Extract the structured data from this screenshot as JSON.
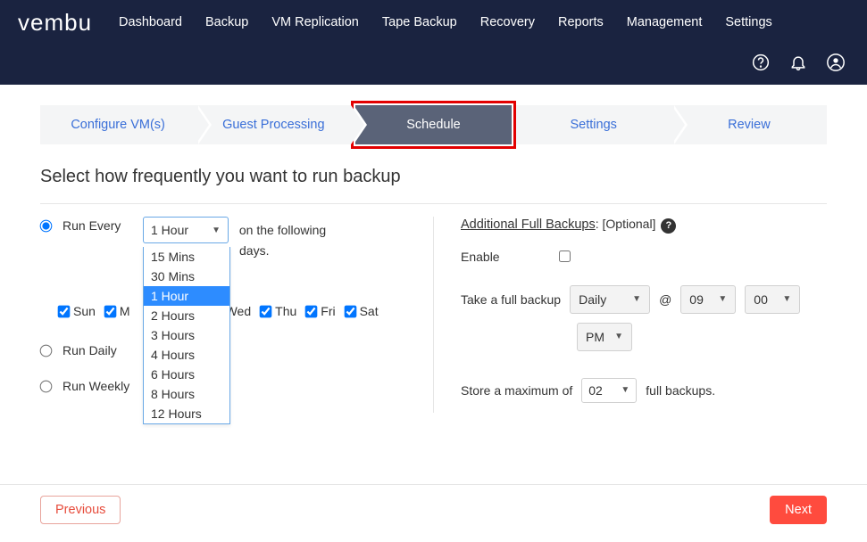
{
  "logo": "vembu",
  "nav": [
    "Dashboard",
    "Backup",
    "VM Replication",
    "Tape Backup",
    "Recovery",
    "Reports",
    "Management",
    "Settings"
  ],
  "wizard": {
    "steps": [
      "Configure VM(s)",
      "Guest Processing",
      "Schedule",
      "Settings",
      "Review"
    ],
    "active_index": 2
  },
  "heading": "Select how frequently you want to run backup",
  "left": {
    "run_every_label": "Run Every",
    "run_daily_label": "Run Daily",
    "run_weekly_label": "Run Weekly",
    "selected_mode": "run_every",
    "frequency_selected": "1 Hour",
    "frequency_options": [
      "15 Mins",
      "30 Mins",
      "1 Hour",
      "2 Hours",
      "3 Hours",
      "4 Hours",
      "6 Hours",
      "8 Hours",
      "12 Hours"
    ],
    "after_text_1": "on the following",
    "after_text_2": "days.",
    "days": [
      {
        "label": "Sun",
        "checked": true
      },
      {
        "label": "M",
        "checked": true
      },
      {
        "label": "Wed",
        "checked": true
      },
      {
        "label": "Thu",
        "checked": true
      },
      {
        "label": "Fri",
        "checked": true
      },
      {
        "label": "Sat",
        "checked": true
      }
    ]
  },
  "right": {
    "title": "Additional Full Backups",
    "optional": ": [Optional]",
    "enable_label": "Enable",
    "enable_checked": false,
    "take_full_label": "Take a full backup",
    "freq_value": "Daily",
    "at_symbol": "@",
    "hour_value": "09",
    "minute_value": "00",
    "ampm_value": "PM",
    "store_label_1": "Store a maximum of",
    "store_value": "02",
    "store_label_2": "full backups."
  },
  "footer": {
    "prev": "Previous",
    "next": "Next"
  }
}
